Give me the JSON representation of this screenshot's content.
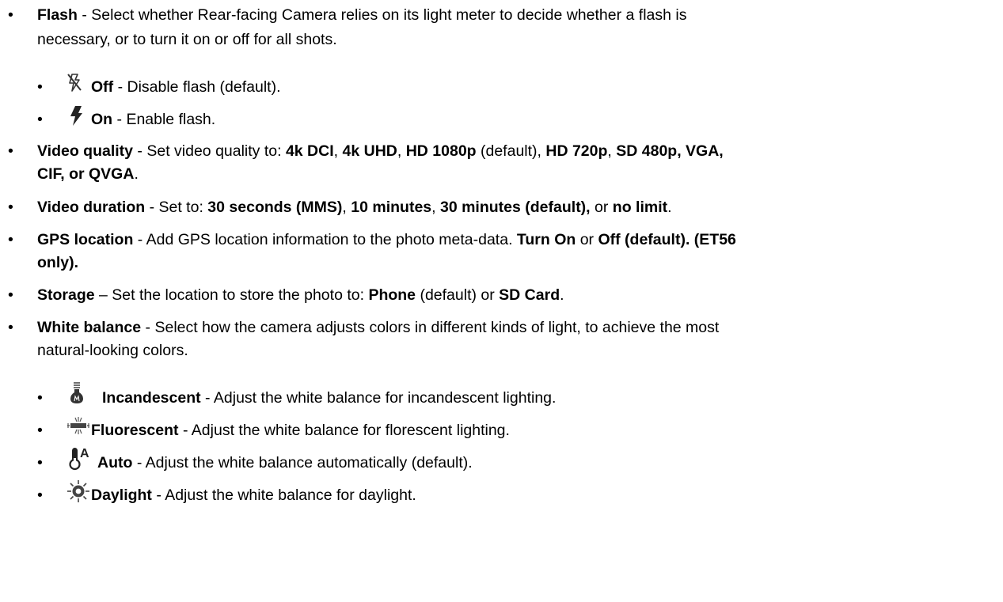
{
  "bullet": "•",
  "items": [
    {
      "term": "Flash",
      "sep": " - ",
      "desc_line1": "Select whether Rear-facing Camera relies on its light meter to decide whether a flash is",
      "desc_line2": "necessary, or to turn it on or off for all shots.",
      "subitems": [
        {
          "icon": "flash-off-icon",
          "term": "Off",
          "sep": " - ",
          "desc": "Disable flash (default)."
        },
        {
          "icon": "flash-on-icon",
          "term": "On",
          "sep": " - ",
          "desc": "Enable flash."
        }
      ]
    },
    {
      "term": "Video quality",
      "sep": " - ",
      "line1_a": "Set video quality to: ",
      "opt1": "4k DCI",
      "c1": ", ",
      "opt2": "4k UHD",
      "c2": ", ",
      "opt3": "HD 1080p",
      "def": " (default), ",
      "opt4": "HD 720p",
      "c3": ", ",
      "opt5": "SD 480p, VGA,",
      "line2_bold": "CIF, or QVGA",
      "line2_end": "."
    },
    {
      "term": "Video duration",
      "sep": " - ",
      "lead": "Set to: ",
      "opt1": "30 seconds (MMS)",
      "c1": ", ",
      "opt2": "10 minutes",
      "c2": ", ",
      "opt3": "30 minutes (default),",
      "or": " or ",
      "opt4": "no limit",
      "end": "."
    },
    {
      "term": "GPS location",
      "sep": " - ",
      "lead": "Add GPS location information to the photo meta-data. ",
      "opt1": "Turn On",
      "or": " or ",
      "opt2": "Off (default). (ET56",
      "line2_bold": "only)."
    },
    {
      "term": "Storage",
      "sep": " – ",
      "lead": "Set the location to store the photo to: ",
      "opt1": "Phone",
      "mid": " (default) or ",
      "opt2": "SD Card",
      "end": "."
    },
    {
      "term": "White balance",
      "sep": " - ",
      "desc_line1": "Select how the camera adjusts colors in different kinds of light, to achieve the most",
      "desc_line2": "natural-looking colors.",
      "subitems": [
        {
          "icon": "incandescent-bulb-icon",
          "term": "Incandescent",
          "sep": " - ",
          "desc": "Adjust the white balance for incandescent lighting."
        },
        {
          "icon": "fluorescent-light-icon",
          "term": "Fluorescent",
          "sep": " - ",
          "desc": "Adjust the white balance for florescent lighting."
        },
        {
          "icon": "auto-white-balance-icon",
          "term": "Auto",
          "sep": " - ",
          "desc": "Adjust the white balance automatically (default)."
        },
        {
          "icon": "daylight-sun-icon",
          "term": "Daylight",
          "sep": " - ",
          "desc": "Adjust the white balance for daylight."
        }
      ]
    }
  ]
}
